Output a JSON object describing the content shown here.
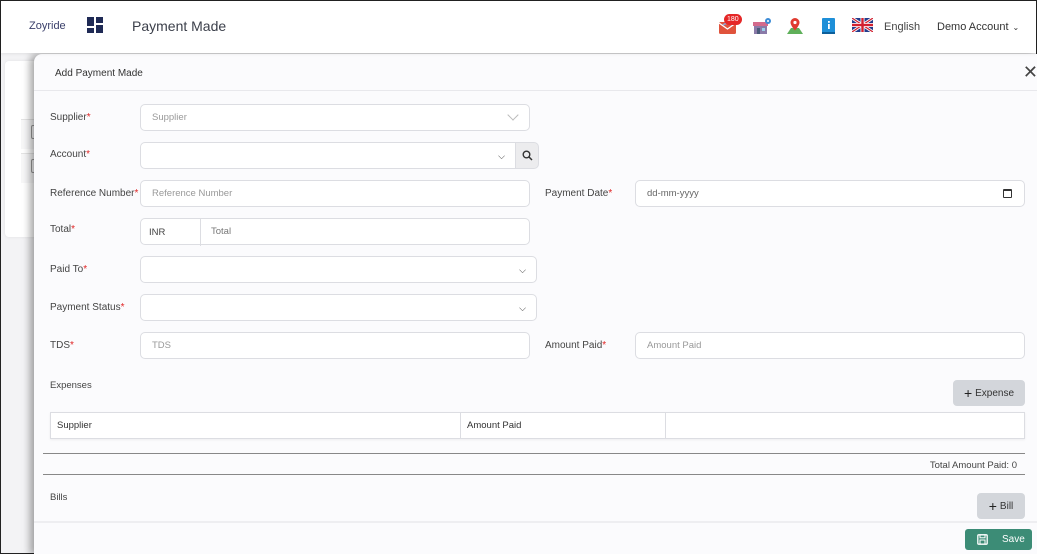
{
  "header": {
    "brand": "Zoyride",
    "page_title": "Payment Made",
    "notification_count": "180",
    "language": "English",
    "account": "Demo Account",
    "icons": [
      "mail-notification-icon",
      "store-location-icon",
      "map-pin-icon",
      "info-book-icon",
      "uk-flag-icon"
    ]
  },
  "modal": {
    "title": "Add Payment Made",
    "close_label": "✕",
    "fields": {
      "supplier": {
        "label": "Supplier",
        "required": "*",
        "placeholder": "Supplier"
      },
      "account": {
        "label": "Account",
        "required": "*",
        "value": ""
      },
      "reference_number": {
        "label": "Reference Number",
        "required": "*",
        "placeholder": "Reference Number"
      },
      "payment_date": {
        "label": "Payment Date",
        "required": "*",
        "placeholder": "dd-mm-yyyy"
      },
      "total": {
        "label": "Total",
        "required": "*",
        "currency": "INR",
        "placeholder": "Total"
      },
      "paid_to": {
        "label": "Paid To",
        "required": "*",
        "value": ""
      },
      "payment_status": {
        "label": "Payment Status",
        "required": "*",
        "value": ""
      },
      "tds": {
        "label": "TDS",
        "required": "*",
        "placeholder": "TDS"
      },
      "amount_paid": {
        "label": "Amount Paid",
        "required": "*",
        "placeholder": "Amount Paid"
      }
    },
    "expenses": {
      "title": "Expenses",
      "add_button": "Expense",
      "columns": [
        "Supplier",
        "Amount Paid",
        ""
      ],
      "rows": [],
      "total_label": "Total Amount Paid: 0"
    },
    "bills": {
      "title": "Bills",
      "add_button": "Bill"
    },
    "save_label": "Save"
  },
  "colors": {
    "save_button": "#3c8c76",
    "required_marker": "#e02424",
    "badge": "#e52727",
    "brand_dark": "#1f2a55"
  }
}
